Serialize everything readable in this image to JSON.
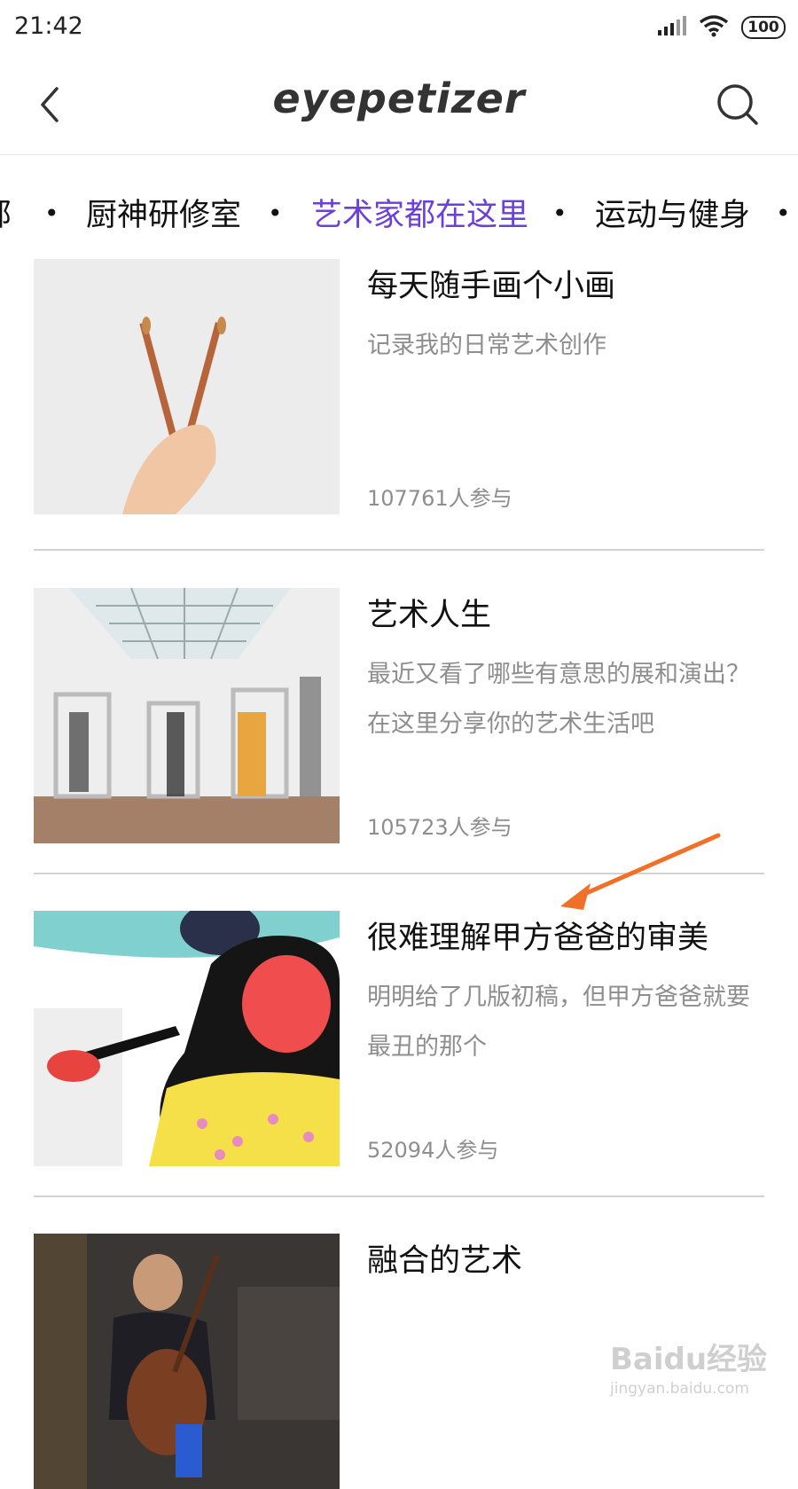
{
  "status_bar": {
    "time": "21:42",
    "battery": "100"
  },
  "header": {
    "logo": "eyepetizer"
  },
  "tabs": [
    {
      "label": "部"
    },
    {
      "label": "厨神研修室"
    },
    {
      "label": "艺术家都在这里",
      "active": true
    },
    {
      "label": "运动与健身"
    }
  ],
  "accent_color": "#6b3fd8",
  "topics": [
    {
      "title": "每天随手画个小画",
      "desc": "记录我的日常艺术创作",
      "count": "107761人参与"
    },
    {
      "title": "艺术人生",
      "desc": "最近又看了哪些有意思的展和演出？在这里分享你的艺术生活吧",
      "count": "105723人参与"
    },
    {
      "title": "很难理解甲方爸爸的审美",
      "desc": "明明给了几版初稿，但甲方爸爸就要最丑的那个",
      "count": "52094人参与"
    },
    {
      "title": "融合的艺术",
      "desc": "",
      "count": ""
    }
  ],
  "watermark": {
    "brand": "Baidu经验",
    "url": "jingyan.baidu.com"
  }
}
